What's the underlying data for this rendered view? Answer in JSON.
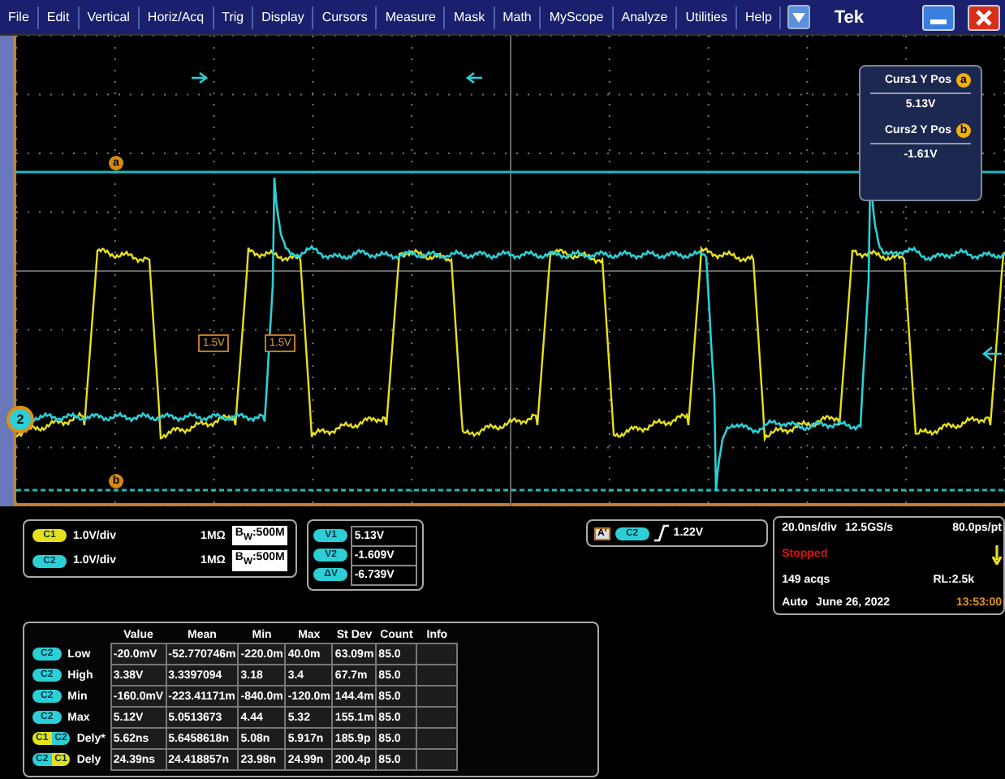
{
  "menu": {
    "items": [
      "File",
      "Edit",
      "Vertical",
      "Horiz/Acq",
      "Trig",
      "Display",
      "Cursors",
      "Measure",
      "Mask",
      "Math",
      "MyScope",
      "Analyze",
      "Utilities",
      "Help"
    ],
    "brand": "Tek"
  },
  "graticule": {
    "cursor_markers": [
      {
        "label": "a"
      },
      {
        "label": "b"
      }
    ],
    "channel_marker": "2",
    "level_labels": [
      "1.5V",
      "1.5V"
    ]
  },
  "cursor_readout": [
    {
      "label": "Curs1 Y Pos",
      "badge": "a",
      "value": "5.13V"
    },
    {
      "label": "Curs2 Y Pos",
      "badge": "b",
      "value": "-1.61V"
    }
  ],
  "channels": [
    {
      "badge": "C1",
      "color": "#e6e01c",
      "scale": "1.0V/div",
      "impedance": "1MΩ",
      "bandwidth": "B$_{W}$:500M"
    },
    {
      "badge": "C2",
      "color": "#2ccfd6",
      "scale": "1.0V/div",
      "impedance": "1MΩ",
      "bandwidth": "B$_{W}$:500M"
    }
  ],
  "cursor_values": [
    {
      "badge": "V1",
      "value": "5.13V"
    },
    {
      "badge": "V2",
      "value": "-1.609V"
    },
    {
      "badge": "ΔV",
      "value": "-6.739V"
    }
  ],
  "trigger": {
    "mode": "A'",
    "source": "C2",
    "level": "1.22V"
  },
  "acquisition": {
    "timebase": "20.0ns/div",
    "sample_rate": "12.5GS/s",
    "resolution": "80.0ps/pt",
    "state": "Stopped",
    "acqs": "149 acqs",
    "record_length": "RL:2.5k",
    "mode": "Auto",
    "date": "June 26, 2022",
    "time": "13:53:00"
  },
  "measurements": {
    "columns": [
      "Value",
      "Mean",
      "Min",
      "Max",
      "St Dev",
      "Count",
      "Info"
    ],
    "rows": [
      {
        "sources": [
          {
            "label": "C2",
            "color": "#2ccfd6"
          }
        ],
        "name": "Low",
        "cells": [
          "-20.0mV",
          "-52.770746m",
          "-220.0m",
          "40.0m",
          "63.09m",
          "85.0"
        ]
      },
      {
        "sources": [
          {
            "label": "C2",
            "color": "#2ccfd6"
          }
        ],
        "name": "High",
        "cells": [
          "3.38V",
          "3.3397094",
          "3.18",
          "3.4",
          "67.7m",
          "85.0"
        ]
      },
      {
        "sources": [
          {
            "label": "C2",
            "color": "#2ccfd6"
          }
        ],
        "name": "Min",
        "cells": [
          "-160.0mV",
          "-223.41171m",
          "-840.0m",
          "-120.0m",
          "144.4m",
          "85.0"
        ]
      },
      {
        "sources": [
          {
            "label": "C2",
            "color": "#2ccfd6"
          }
        ],
        "name": "Max",
        "cells": [
          "5.12V",
          "5.0513673",
          "4.44",
          "5.32",
          "155.1m",
          "85.0"
        ]
      },
      {
        "sources": [
          {
            "label": "C1",
            "color": "#e6e01c"
          },
          {
            "label": "C2",
            "color": "#2ccfd6"
          }
        ],
        "name": "Dely*",
        "cells": [
          "5.62ns",
          "5.6458618n",
          "5.08n",
          "5.917n",
          "185.9p",
          "85.0"
        ]
      },
      {
        "sources": [
          {
            "label": "C2",
            "color": "#2ccfd6"
          },
          {
            "label": "C1",
            "color": "#e6e01c"
          }
        ],
        "name": "Dely",
        "cells": [
          "24.39ns",
          "24.418857n",
          "23.98n",
          "24.99n",
          "200.4p",
          "85.0"
        ]
      }
    ]
  }
}
